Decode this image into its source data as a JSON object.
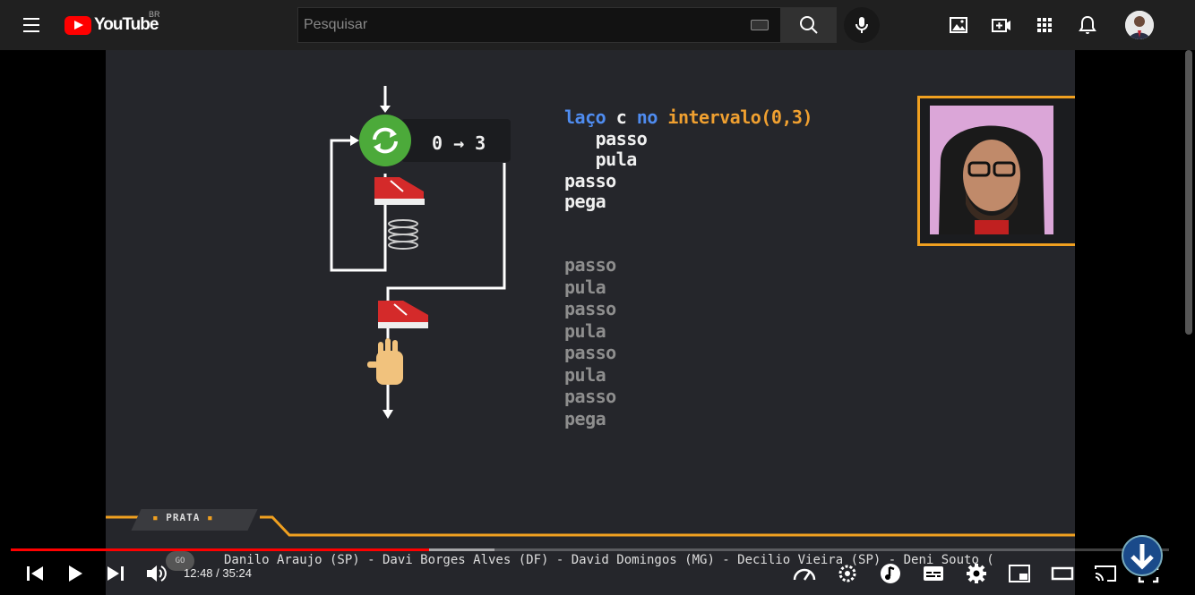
{
  "header": {
    "logo_text": "YouTube",
    "region": "BR",
    "search_placeholder": "Pesquisar"
  },
  "video": {
    "code_lines": [
      {
        "parts": [
          {
            "t": "laço",
            "c": "blue"
          },
          {
            "t": " c ",
            "c": "white"
          },
          {
            "t": "no",
            "c": "blue"
          },
          {
            "t": " intervalo(0,3)",
            "c": "orange"
          }
        ]
      },
      {
        "parts": [
          {
            "t": "   passo",
            "c": "white"
          }
        ]
      },
      {
        "parts": [
          {
            "t": "   pula",
            "c": "white"
          }
        ]
      },
      {
        "parts": [
          {
            "t": "passo",
            "c": "white"
          }
        ]
      },
      {
        "parts": [
          {
            "t": "pega",
            "c": "white"
          }
        ]
      }
    ],
    "output_lines": [
      "passo",
      "pula",
      "passo",
      "pula",
      "passo",
      "pula",
      "passo",
      "pega"
    ],
    "range_label": "0 → 3",
    "badge_label": "PRATA",
    "badge_dot": "▪",
    "go_label": "GO",
    "ticker_names": "Danilo Araujo (SP) - Davi Borges Alves (DF) - David Domingos (MG) - Decilio Vieira (SP) - Deni Souto (",
    "colors": {
      "blue": "#4f8cf0",
      "orange": "#f0a030",
      "loop_green": "#4caa3a",
      "cam_border": "#f0a020"
    }
  },
  "player": {
    "time_current": "12:48",
    "time_total": "35:24",
    "time_separator": " / ",
    "progress": 0.3614,
    "buffered": 0.418
  }
}
